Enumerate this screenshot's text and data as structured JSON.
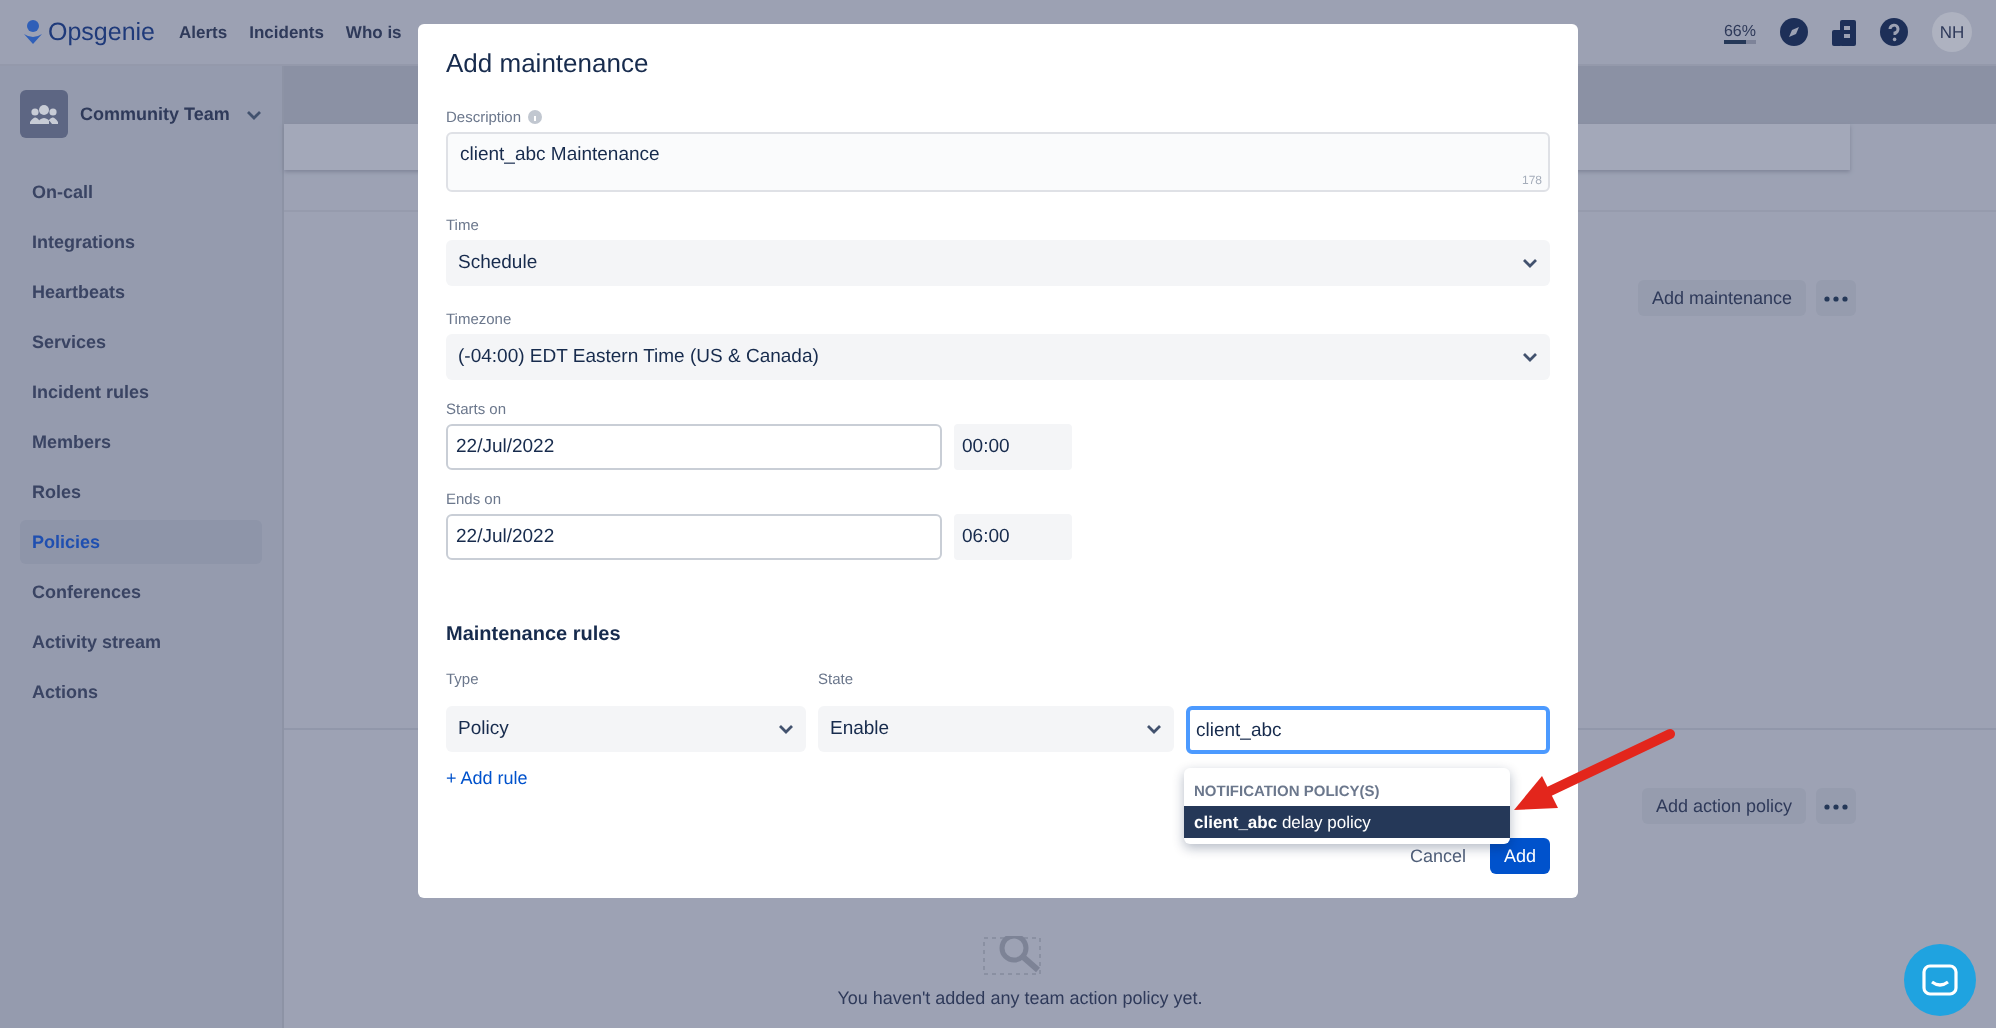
{
  "top_nav": {
    "logo": "Opsgenie",
    "links": [
      "Alerts",
      "Incidents",
      "Who is"
    ],
    "usage": {
      "text": "66%",
      "level": 0.66
    },
    "avatar": "NH"
  },
  "sidebar": {
    "team": "Community Team",
    "items": [
      {
        "label": "On-call",
        "selected": false
      },
      {
        "label": "Integrations",
        "selected": false
      },
      {
        "label": "Heartbeats",
        "selected": false
      },
      {
        "label": "Services",
        "selected": false
      },
      {
        "label": "Incident rules",
        "selected": false
      },
      {
        "label": "Members",
        "selected": false
      },
      {
        "label": "Roles",
        "selected": false
      },
      {
        "label": "Policies",
        "selected": true
      },
      {
        "label": "Conferences",
        "selected": false
      },
      {
        "label": "Activity stream",
        "selected": false
      },
      {
        "label": "Actions",
        "selected": false
      }
    ]
  },
  "main": {
    "add_maintenance_button": "Add maintenance",
    "add_action_policy_button": "Add action policy",
    "empty_message": "You haven't added any team action policy yet."
  },
  "dialog": {
    "title": "Add maintenance",
    "description": {
      "label": "Description",
      "value": "client_abc Maintenance",
      "counter": "178"
    },
    "time": {
      "label": "Time",
      "value": "Schedule"
    },
    "timezone": {
      "label": "Timezone",
      "value": "(-04:00) EDT Eastern Time (US & Canada)"
    },
    "starts_on": {
      "label": "Starts on",
      "date": "22/Jul/2022",
      "time": "00:00"
    },
    "ends_on": {
      "label": "Ends on",
      "date": "22/Jul/2022",
      "time": "06:00"
    },
    "rules_title": "Maintenance rules",
    "rule_columns": [
      "Type",
      "State"
    ],
    "rule": {
      "type": "Policy",
      "state": "Enable",
      "search": "client_abc"
    },
    "add_rule": "+ Add rule",
    "suggestions": {
      "header": "NOTIFICATION POLICY(S)",
      "items": [
        {
          "label": "**client_abc** delay policy",
          "selected": true
        }
      ]
    },
    "buttons": {
      "cancel": "Cancel",
      "add": "Add"
    }
  }
}
